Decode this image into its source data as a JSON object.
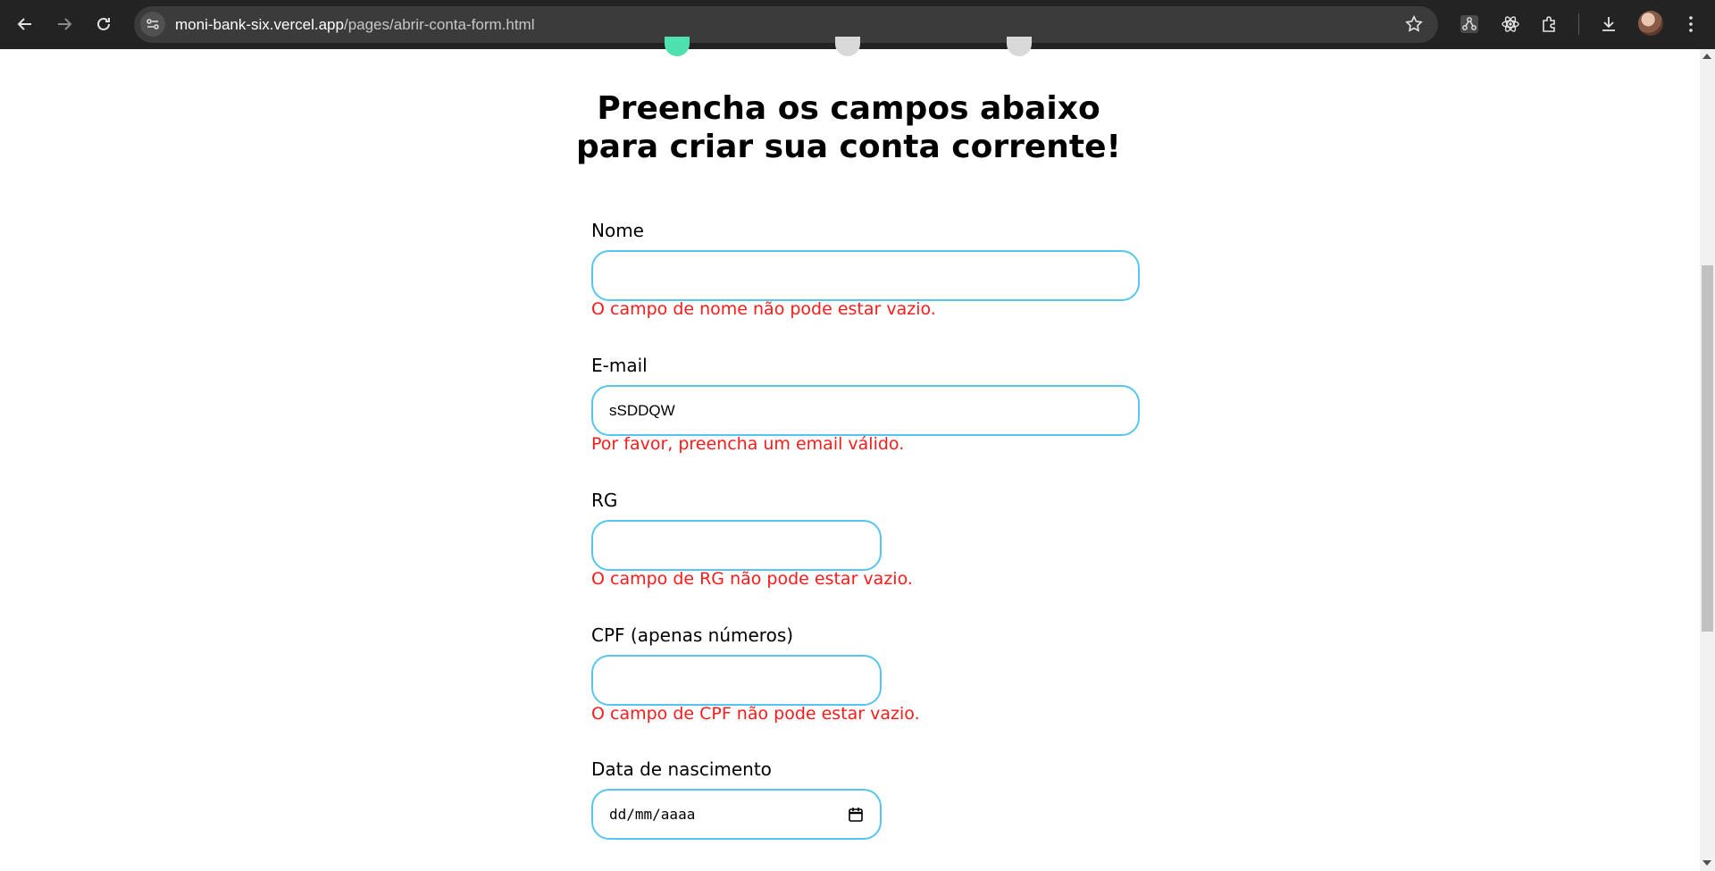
{
  "browser": {
    "url_host": "moni-bank-six.vercel.app",
    "url_path": "/pages/abrir-conta-form.html"
  },
  "progress": {
    "steps": 3,
    "current_step": 1
  },
  "form": {
    "title_line1": "Preencha os campos abaixo",
    "title_line2": "para criar sua conta corrente!",
    "fields": [
      {
        "label": "Nome",
        "value": "",
        "error": "O campo de nome não pode estar vazio."
      },
      {
        "label": "E-mail",
        "value": "sSDDQW",
        "error": "Por favor, preencha um email válido."
      },
      {
        "label": "RG",
        "value": "",
        "error": "O campo de RG não pode estar vazio."
      },
      {
        "label": "CPF (apenas números)",
        "value": "",
        "error": "O campo de CPF não pode estar vazio."
      },
      {
        "label": "Data de nascimento",
        "placeholder": "dd/mm/aaaa"
      }
    ]
  },
  "colors": {
    "input_border": "#56c6f0",
    "error_text": "#ff1a1a",
    "active_step": "#4fe0b0",
    "inactive_step": "#d9d9d9"
  }
}
